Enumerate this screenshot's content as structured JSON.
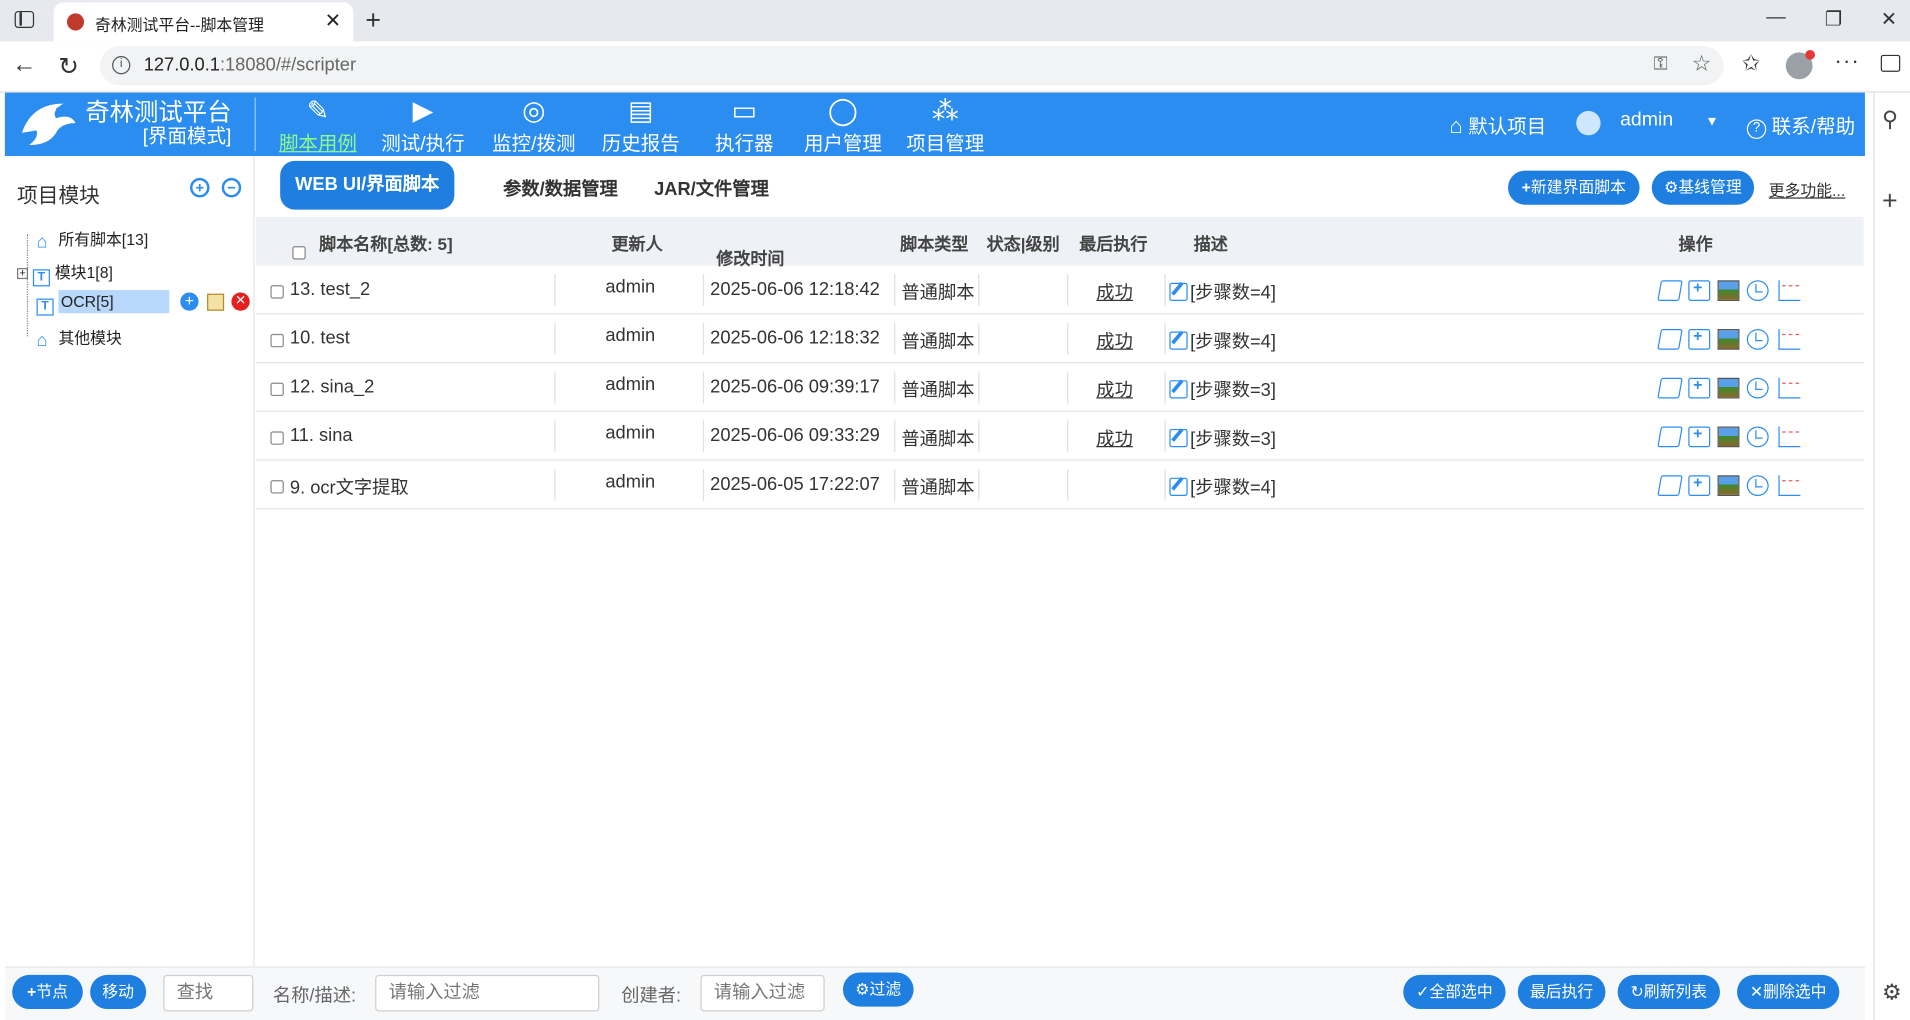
{
  "browser": {
    "tab_title": "奇林测试平台--脚本管理",
    "url_host": "127.0.0.1",
    "url_rest": ":18080/#/scripter"
  },
  "brand": {
    "title": "奇林测试平台",
    "subtitle": "[界面模式]"
  },
  "nav": [
    {
      "label": "脚本用例",
      "icon": "pencil-icon",
      "active": true
    },
    {
      "label": "测试/执行",
      "icon": "play-icon"
    },
    {
      "label": "监控/拨测",
      "icon": "monitor-dial-icon"
    },
    {
      "label": "历史报告",
      "icon": "report-icon"
    },
    {
      "label": "执行器",
      "icon": "desktop-icon"
    },
    {
      "label": "用户管理",
      "icon": "user-icon"
    },
    {
      "label": "项目管理",
      "icon": "project-icon"
    }
  ],
  "header_right": {
    "project": "默认项目",
    "user": "admin",
    "help": "联系/帮助"
  },
  "sidebar": {
    "title": "项目模块",
    "tree": [
      {
        "label": "所有脚本[13]",
        "icon": "home-icon"
      },
      {
        "label": "模块1[8]",
        "icon": "module-icon"
      },
      {
        "label": "OCR[5]",
        "icon": "module-icon",
        "selected": true
      },
      {
        "label": "其他模块",
        "icon": "home-icon"
      }
    ]
  },
  "subtabs": {
    "active": "WEB UI/界面脚本",
    "tab2": "参数/数据管理",
    "tab3": "JAR/文件管理"
  },
  "actions": {
    "new_script": "新建界面脚本",
    "baseline": "基线管理",
    "more": "更多功能..."
  },
  "table": {
    "headers": {
      "name": "脚本名称[总数: 5]",
      "updater": "更新人",
      "modified": "修改时间",
      "type": "脚本类型",
      "status": "状态|级别",
      "last_run": "最后执行",
      "desc": "描述",
      "ops": "操作"
    },
    "rows": [
      {
        "name": "13. test_2",
        "updater": "admin",
        "modified": "2025-06-06 12:18:42",
        "type": "普通脚本",
        "status": "",
        "last_run": "成功",
        "desc": "[步骤数=4]"
      },
      {
        "name": "10. test",
        "updater": "admin",
        "modified": "2025-06-06 12:18:32",
        "type": "普通脚本",
        "status": "",
        "last_run": "成功",
        "desc": "[步骤数=4]"
      },
      {
        "name": "12. sina_2",
        "updater": "admin",
        "modified": "2025-06-06 09:39:17",
        "type": "普通脚本",
        "status": "",
        "last_run": "成功",
        "desc": "[步骤数=3]"
      },
      {
        "name": "11. sina",
        "updater": "admin",
        "modified": "2025-06-06 09:33:29",
        "type": "普通脚本",
        "status": "",
        "last_run": "成功",
        "desc": "[步骤数=3]"
      },
      {
        "name": "9. ocr文字提取",
        "updater": "admin",
        "modified": "2025-06-05 17:22:07",
        "type": "普通脚本",
        "status": "",
        "last_run": "",
        "desc": "[步骤数=4]"
      }
    ]
  },
  "footer": {
    "node_btn": "节点",
    "move_btn": "移动",
    "search_placeholder": "查找",
    "name_label": "名称/描述:",
    "name_placeholder": "请输入过滤",
    "creator_label": "创建者:",
    "creator_placeholder": "请输入过滤",
    "filter_btn": "过滤",
    "select_all": "全部选中",
    "last_run": "最后执行",
    "refresh": "刷新列表",
    "delete_selected": "删除选中"
  },
  "colors": {
    "header_bg": "#2b8df0",
    "accent": "#1f7fe0",
    "active_nav": "#8dfa8a"
  }
}
